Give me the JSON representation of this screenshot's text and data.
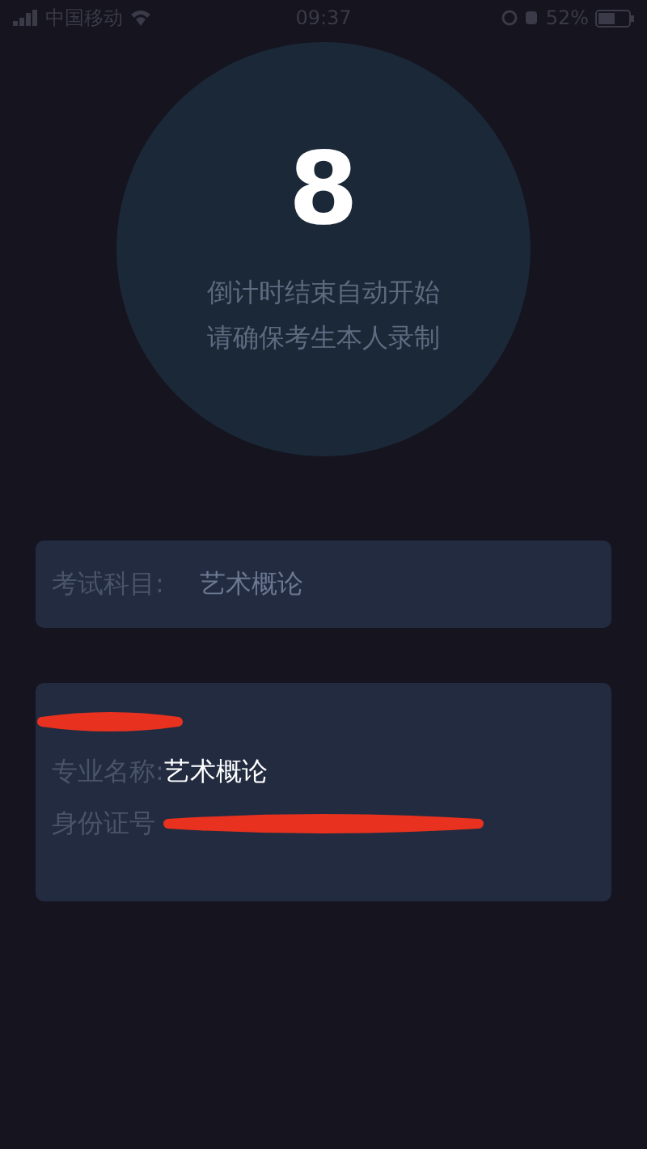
{
  "status_bar": {
    "carrier": "中国移动",
    "time": "09:37",
    "battery": "52%"
  },
  "countdown": {
    "number": "8",
    "lines": [
      "倒计时结束自动开始",
      "请确保考生本人录制"
    ]
  },
  "subject": {
    "label": "考试科目:",
    "value": "艺术概论"
  },
  "candidate": {
    "name_redacted": true,
    "fields": [
      {
        "label": "专业名称:",
        "value": "艺术概论",
        "redacted": false
      },
      {
        "label": "身份证号",
        "redacted": true
      }
    ]
  }
}
